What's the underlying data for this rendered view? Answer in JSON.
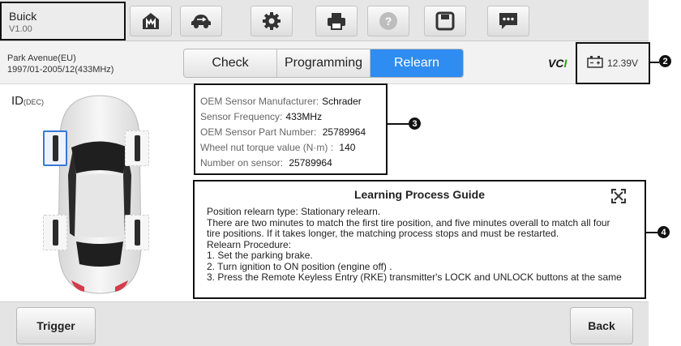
{
  "header": {
    "vehicle_make": "Buick",
    "software_version": "V1.00",
    "toolbar_icons": [
      "home-icon",
      "vehicle-swap-icon",
      "settings-icon",
      "print-icon",
      "help-icon",
      "save-icon",
      "message-icon"
    ]
  },
  "vehicle": {
    "model": "Park Avenue(EU)",
    "year_range": "1997/01-2005/12(433MHz)"
  },
  "tabs": [
    {
      "label": "Check",
      "active": false
    },
    {
      "label": "Programming",
      "active": false
    },
    {
      "label": "Relearn",
      "active": true
    }
  ],
  "status": {
    "vci_logo": "VCI",
    "battery_voltage": "12.39V"
  },
  "callouts": [
    "2",
    "3",
    "4"
  ],
  "id_label": {
    "text": "ID",
    "unit": "(DEC)"
  },
  "sensor_info": [
    {
      "label": "OEM Sensor Manufacturer:",
      "value": "Schrader"
    },
    {
      "label": "Sensor Frequency:",
      "value": "433MHz"
    },
    {
      "label": "OEM Sensor Part Number:",
      "value": " 25789964"
    },
    {
      "label": "Wheel nut torque value (N·m) :",
      "value": " 140"
    },
    {
      "label": "Number on sensor:",
      "value": " 25789964"
    }
  ],
  "guide": {
    "title": "Learning Process Guide",
    "lines": [
      "Position relearn type: Stationary relearn.",
      "There are two minutes to match the first tire position, and five minutes overall to match all four",
      "tire positions. If it takes longer, the matching process stops and must be restarted.",
      "Relearn Procedure:",
      "1. Set the parking brake.",
      "2. Turn ignition to ON position (engine off) .",
      "3. Press the Remote Keyless Entry (RKE) transmitter's LOCK and UNLOCK buttons at the same"
    ]
  },
  "footer": {
    "trigger_label": "Trigger",
    "back_label": "Back"
  },
  "colors": {
    "accent": "#2f8cf0",
    "selected_sensor": "#3a78d6",
    "vci_green": "#2aa01a"
  }
}
